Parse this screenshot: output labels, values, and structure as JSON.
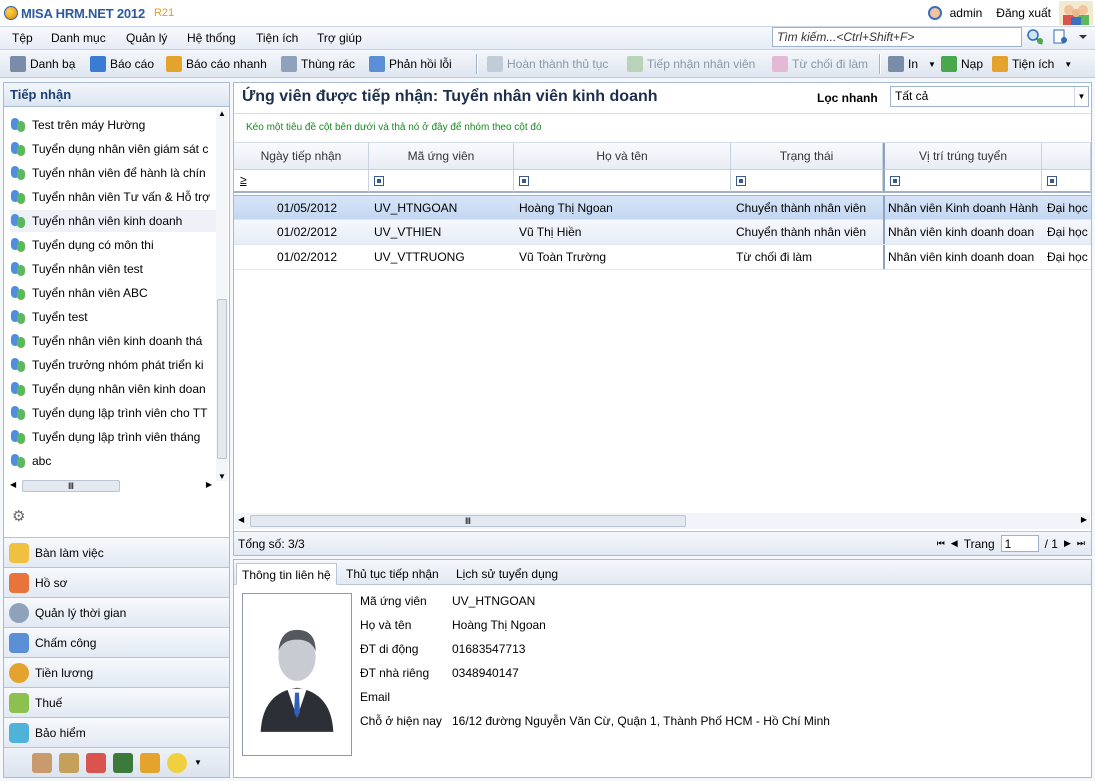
{
  "app": {
    "brand": "MISA HRM.NET 2012",
    "version": "R21",
    "user": "admin",
    "logout": "Đăng xuất"
  },
  "menu": [
    "Tệp",
    "Danh mục",
    "Quản lý",
    "Hệ thống",
    "Tiện ích",
    "Trợ giúp"
  ],
  "search": {
    "placeholder": "Tìm kiếm...<Ctrl+Shift+F>"
  },
  "toolbar": {
    "danh_ba": "Danh bạ",
    "bao_cao": "Báo cáo",
    "bao_cao_nhanh": "Báo cáo nhanh",
    "thung_rac": "Thùng rác",
    "phan_hoi": "Phản hồi lỗi",
    "hoan_thanh": "Hoàn thành thủ tục",
    "tiep_nhan": "Tiếp nhận nhân viên",
    "tu_choi": "Từ chối đi làm",
    "in": "In",
    "nap": "Nạp",
    "tien_ich": "Tiện ích"
  },
  "sidebar": {
    "title": "Tiếp nhận",
    "items": [
      "Test trên máy Hường",
      "Tuyển dụng nhân viên giám sát c",
      "Tuyển nhân viên để hành là chín",
      "Tuyển nhân viên Tư vấn & Hỗ trợ",
      "Tuyển nhân viên kinh doanh",
      "Tuyển dụng có môn thi",
      "Tuyển nhân viên test",
      "Tuyển nhân viên ABC",
      "Tuyển test",
      "Tuyển nhân viên kinh doanh thá",
      "Tuyển trưởng nhóm phát triển ki",
      "Tuyển dụng nhân viên kinh doan",
      "Tuyển dụng lập trình viên cho TT",
      "Tuyển dụng lập trình viên tháng",
      "abc"
    ],
    "selected_index": 4,
    "nav": [
      "Bàn làm việc",
      "Hồ sơ",
      "Quản lý thời gian",
      "Chấm công",
      "Tiền lương",
      "Thuế",
      "Bảo hiểm"
    ]
  },
  "main": {
    "title": "Ứng viên được tiếp nhận: Tuyển nhân viên kinh doanh",
    "quick_filter_label": "Lọc nhanh",
    "quick_filter_value": "Tất cả",
    "group_hint": "Kéo một tiêu đề cột bên dưới và thả nó ở đây để nhóm theo cột đó",
    "columns": [
      "Ngày tiếp nhận",
      "Mã ứng viên",
      "Họ và tên",
      "Trạng thái",
      "Vị trí trúng tuyển",
      ""
    ],
    "filter_date_op": "≥",
    "rows": [
      [
        "01/05/2012",
        "UV_HTNGOAN",
        "Hoàng Thị Ngoan",
        "Chuyển thành nhân viên",
        "Nhân viên Kinh doanh Hành",
        "Đại học"
      ],
      [
        "01/02/2012",
        "UV_VTHIEN",
        "Vũ Thị Hiền",
        "Chuyển thành nhân viên",
        "Nhân viên kinh doanh doan",
        "Đại học"
      ],
      [
        "01/02/2012",
        "UV_VTTRUONG",
        "Vũ Toàn Trường",
        "Từ chối đi làm",
        "Nhân viên kinh doanh doan",
        "Đại học"
      ]
    ],
    "total": "Tổng số: 3/3",
    "page_label": "Trang",
    "page_value": "1",
    "page_total": "/ 1"
  },
  "detail": {
    "tabs": [
      "Thông tin liên hệ",
      "Thủ tục tiếp nhận",
      "Lịch sử tuyển dụng"
    ],
    "fields": [
      {
        "label": "Mã ứng viên",
        "value": "UV_HTNGOAN"
      },
      {
        "label": "Họ và tên",
        "value": "Hoàng Thị Ngoan"
      },
      {
        "label": "ĐT di động",
        "value": "01683547713"
      },
      {
        "label": "ĐT nhà riêng",
        "value": "0348940147"
      },
      {
        "label": "Email",
        "value": ""
      },
      {
        "label": "Chỗ ở hiện nay",
        "value": "16/12 đường Nguyễn Văn Cừ, Quận 1, Thành Phố HCM - Hồ Chí Minh"
      }
    ]
  }
}
